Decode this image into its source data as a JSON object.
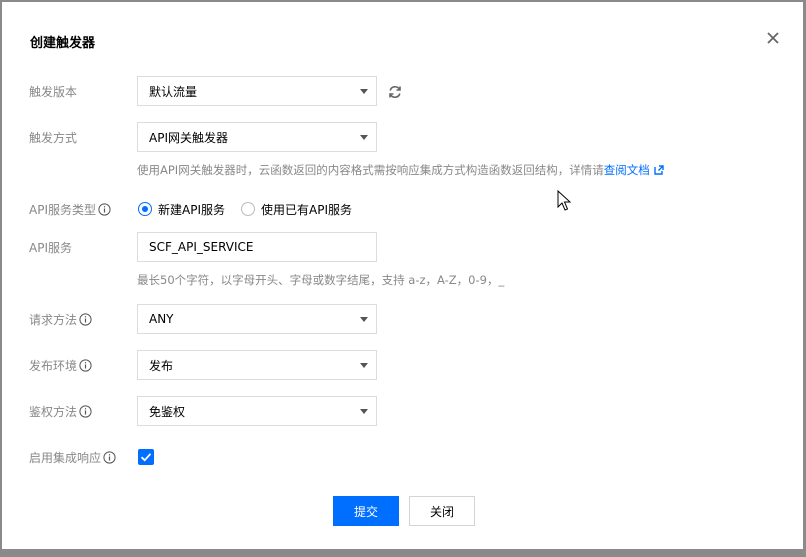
{
  "dialog": {
    "title": "创建触发器"
  },
  "form": {
    "version": {
      "label": "触发版本",
      "value": "默认流量"
    },
    "method": {
      "label": "触发方式",
      "value": "API网关触发器",
      "hint": "使用API网关触发器时，云函数返回的内容格式需按响应集成方式构造函数返回结构，详情请",
      "hint_link": "查阅文档"
    },
    "service_type": {
      "label": "API服务类型",
      "options": [
        {
          "label": "新建API服务",
          "selected": true
        },
        {
          "label": "使用已有API服务",
          "selected": false
        }
      ]
    },
    "service": {
      "label": "API服务",
      "value": "SCF_API_SERVICE",
      "hint": "最长50个字符，以字母开头、字母或数字结尾，支持 a-z，A-Z，0-9，_"
    },
    "request_method": {
      "label": "请求方法",
      "value": "ANY"
    },
    "environment": {
      "label": "发布环境",
      "value": "发布"
    },
    "auth": {
      "label": "鉴权方法",
      "value": "免鉴权"
    },
    "integration": {
      "label": "启用集成响应",
      "checked": true
    }
  },
  "buttons": {
    "submit": "提交",
    "close": "关闭"
  },
  "colors": {
    "accent": "#006eff",
    "label": "#888888"
  }
}
